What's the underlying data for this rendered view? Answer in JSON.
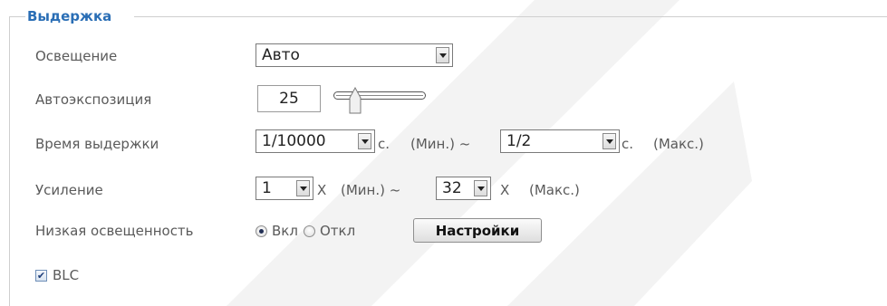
{
  "section": {
    "legend": "Выдержка"
  },
  "lighting": {
    "label": "Освещение",
    "value": "Авто"
  },
  "auto_exposure": {
    "label": "Автоэкспозиция",
    "value": "25",
    "slider_level": 0.25
  },
  "shutter": {
    "label": "Время выдержки",
    "min_value": "1/10000",
    "min_unit": "с.",
    "min_text": "(Мин.) ~",
    "max_value": "1/2",
    "max_unit": "с.",
    "max_text": "(Макс.)"
  },
  "gain": {
    "label": "Усиление",
    "min_value": "1",
    "min_unit": "X",
    "min_text": "(Мин.) ~",
    "max_value": "32",
    "max_unit": "X",
    "max_text": "(Макс.)"
  },
  "low_light": {
    "label": "Низкая освещенность",
    "on_label": "Вкл",
    "off_label": "Откл",
    "selected": "on",
    "settings_button": "Настройки"
  },
  "blc": {
    "label": "BLC",
    "checked": true
  },
  "colors": {
    "legend": "#2a6eb5",
    "label": "#5a5a5a",
    "watermark": "#f2f2f2"
  }
}
